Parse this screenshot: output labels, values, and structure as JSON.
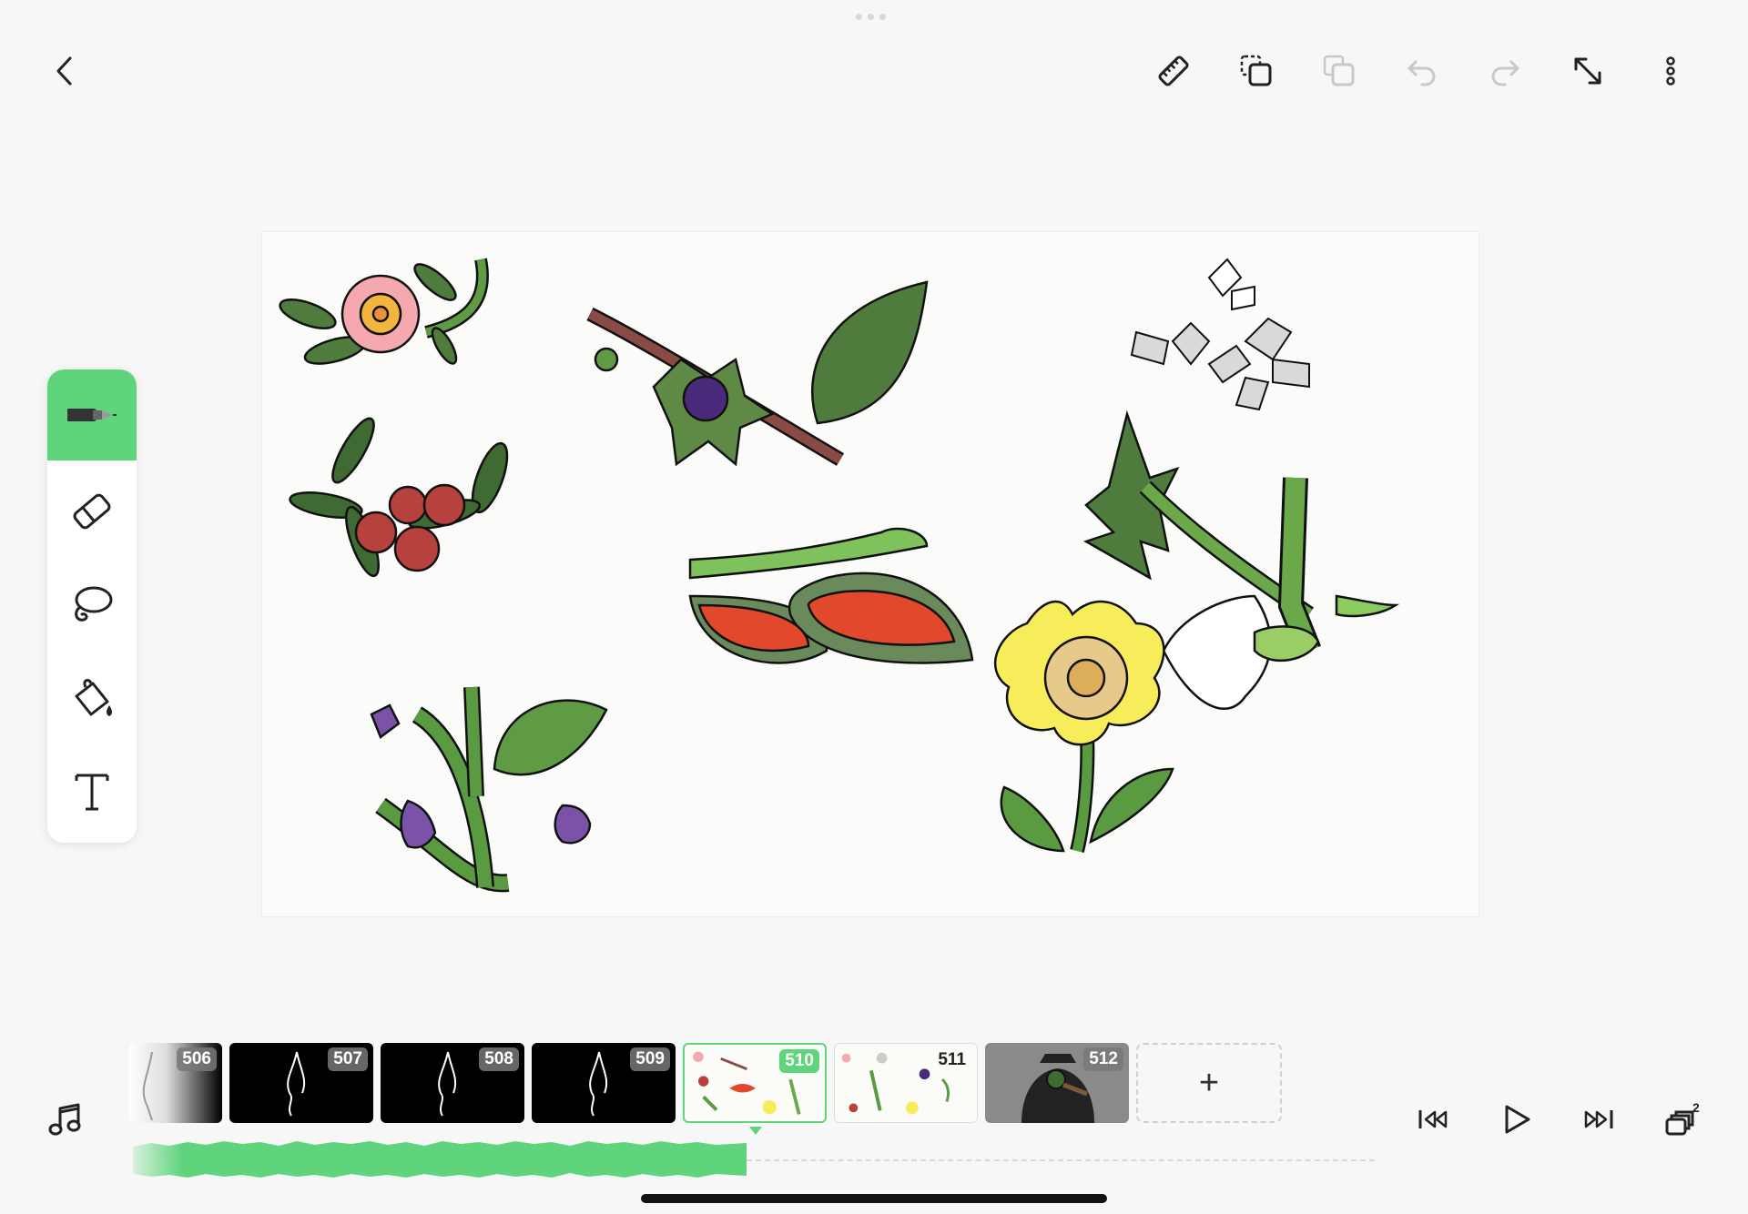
{
  "header": {
    "back_icon": "chevron-left-icon",
    "tools": [
      {
        "name": "ruler-icon"
      },
      {
        "name": "copy-frame-icon"
      },
      {
        "name": "paste-frame-icon"
      },
      {
        "name": "undo-icon"
      },
      {
        "name": "redo-icon"
      },
      {
        "name": "fullscreen-icon"
      },
      {
        "name": "more-icon"
      }
    ]
  },
  "toolbox": {
    "active_tool": "pen",
    "tools": [
      "pen-icon",
      "eraser-icon",
      "lasso-icon",
      "fill-bucket-icon",
      "text-icon"
    ],
    "active_color": "#5fd47c"
  },
  "timeline": {
    "frames": [
      {
        "number": "506",
        "style": "dark-fade"
      },
      {
        "number": "507",
        "style": "dark"
      },
      {
        "number": "508",
        "style": "dark"
      },
      {
        "number": "509",
        "style": "dark"
      },
      {
        "number": "510",
        "style": "selected"
      },
      {
        "number": "511",
        "style": "light"
      },
      {
        "number": "512",
        "style": "grey"
      }
    ],
    "add_frame_label": "+",
    "layers_count": "2"
  },
  "colors": {
    "accent": "#5fd47c",
    "background": "#f7f7f7",
    "canvas": "#fbfbf9"
  }
}
